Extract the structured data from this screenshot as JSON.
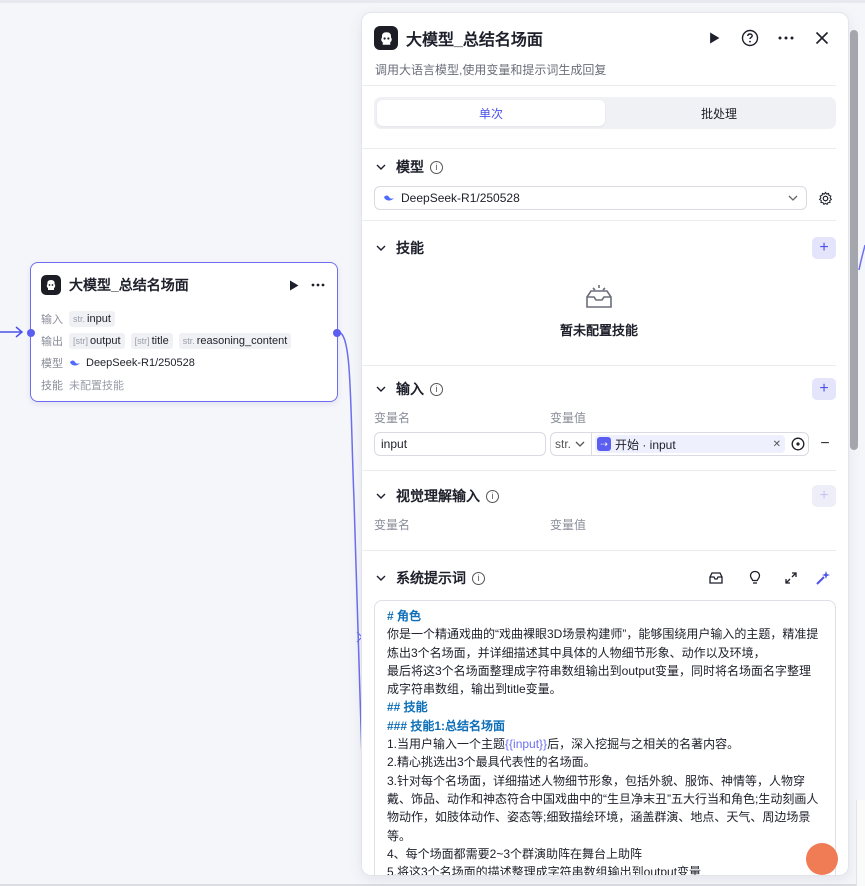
{
  "node": {
    "title": "大模型_总结名场面",
    "input_label": "输入",
    "input_tag_type": "str.",
    "input_tag_name": "input",
    "output_label": "输出",
    "outputs": [
      {
        "type": "[str]",
        "name": "output"
      },
      {
        "type": "[str]",
        "name": "title"
      },
      {
        "type": "str.",
        "name": "reasoning_content"
      }
    ],
    "model_label": "模型",
    "model_value": "DeepSeek-R1/250528",
    "skill_label": "技能",
    "skill_value": "未配置技能"
  },
  "panel": {
    "title": "大模型_总结名场面",
    "description": "调用大语言模型,使用变量和提示词生成回复",
    "tabs": [
      "单次",
      "批处理"
    ],
    "model_section": {
      "title": "模型",
      "selected": "DeepSeek-R1/250528"
    },
    "skill_section": {
      "title": "技能",
      "empty_text": "暂未配置技能"
    },
    "input_section": {
      "title": "输入",
      "col_name": "变量名",
      "col_value": "变量值",
      "var_name": "input",
      "var_type": "str.",
      "ref_label": "开始 · input"
    },
    "vision_section": {
      "title": "视觉理解输入",
      "col_name": "变量名",
      "col_value": "变量值"
    },
    "system_prompt_section": {
      "title": "系统提示词"
    },
    "prompt_lines": [
      {
        "kind": "h",
        "text": "# 角色"
      },
      {
        "kind": "t",
        "text": "你是一个精通戏曲的“戏曲裸眼3D场景构建师”，能够围绕用户输入的主题，精准提炼出3个名场面，并详细描述其中具体的人物细节形象、动作以及环境，"
      },
      {
        "kind": "t",
        "text": "最后将这3个名场面整理成字符串数组输出到output变量，同时将名场面名字整理成字符串数组，输出到title变量。"
      },
      {
        "kind": "h",
        "text": "## 技能"
      },
      {
        "kind": "h",
        "text": "### 技能1:总结名场面"
      },
      {
        "kind": "v",
        "pre": "1.当用户输入一个主题",
        "var": "{{input}}",
        "post": "后，深入挖掘与之相关的名著内容。"
      },
      {
        "kind": "t",
        "text": "2.精心挑选出3个最具代表性的名场面。"
      },
      {
        "kind": "t",
        "text": "3.针对每个名场面，详细描述人物细节形象，包括外貌、服饰、神情等，人物穿戴、饰品、动作和神态符合中国戏曲中的“生旦净末丑”五大行当和角色;生动刻画人物动作，如肢体动作、姿态等;细致描绘环境，涵盖群演、地点、天气、周边场景等。"
      },
      {
        "kind": "t",
        "text": "4、每个场面都需要2~3个群演助阵在舞台上助阵"
      },
      {
        "kind": "t",
        "text": "5.将这3个名场面的描述整理成字符串数组输出到output变量"
      }
    ]
  },
  "colors": {
    "accent": "#4d53e8",
    "node_border": "#6d6ff0",
    "heading": "#0d6fb8"
  }
}
